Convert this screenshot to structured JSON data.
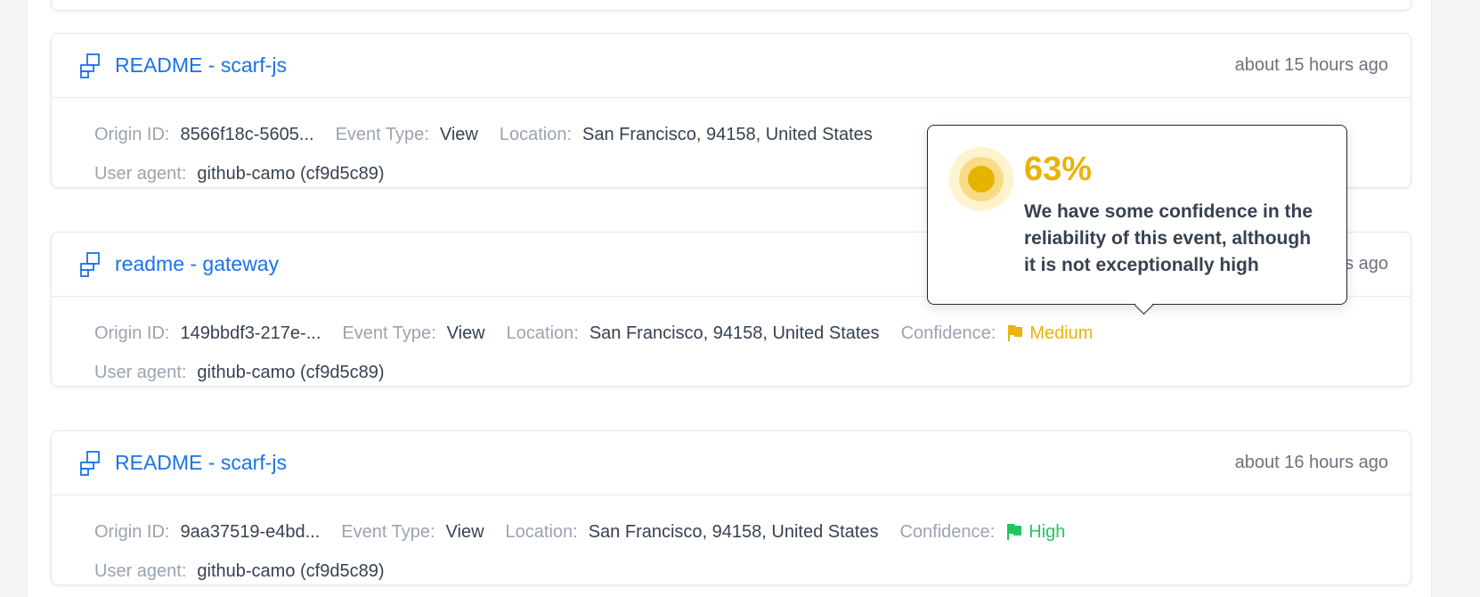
{
  "colors": {
    "link": "#1a73e8",
    "medium": "#eab308",
    "high": "#22c55e"
  },
  "events": [
    {
      "title": "README - scarf-js",
      "time": "about 15 hours ago",
      "origin_label": "Origin ID:",
      "origin": "8566f18c-5605...",
      "event_type_label": "Event Type:",
      "event_type": "View",
      "location_label": "Location:",
      "location": "San Francisco, 94158, United States",
      "user_agent_label": "User agent:",
      "user_agent": "github-camo (cf9d5c89)"
    },
    {
      "title": "readme - gateway",
      "time": "about 15 hours ago",
      "origin_label": "Origin ID:",
      "origin": "149bbdf3-217e-...",
      "event_type_label": "Event Type:",
      "event_type": "View",
      "location_label": "Location:",
      "location": "San Francisco, 94158, United States",
      "confidence_label": "Confidence:",
      "confidence": "Medium",
      "user_agent_label": "User agent:",
      "user_agent": "github-camo (cf9d5c89)"
    },
    {
      "title": "README - scarf-js",
      "time": "about 16 hours ago",
      "origin_label": "Origin ID:",
      "origin": "9aa37519-e4bd...",
      "event_type_label": "Event Type:",
      "event_type": "View",
      "location_label": "Location:",
      "location": "San Francisco, 94158, United States",
      "confidence_label": "Confidence:",
      "confidence": "High",
      "user_agent_label": "User agent:",
      "user_agent": "github-camo (cf9d5c89)"
    }
  ],
  "tooltip": {
    "percent": "63%",
    "confidence_value": 0.63,
    "text": "We have some confidence in the reliability of this event, although it is not exceptionally high",
    "icon": "confidence-gauge-icon"
  },
  "icons": {
    "package": "package-icon",
    "flag": "flag-icon"
  }
}
